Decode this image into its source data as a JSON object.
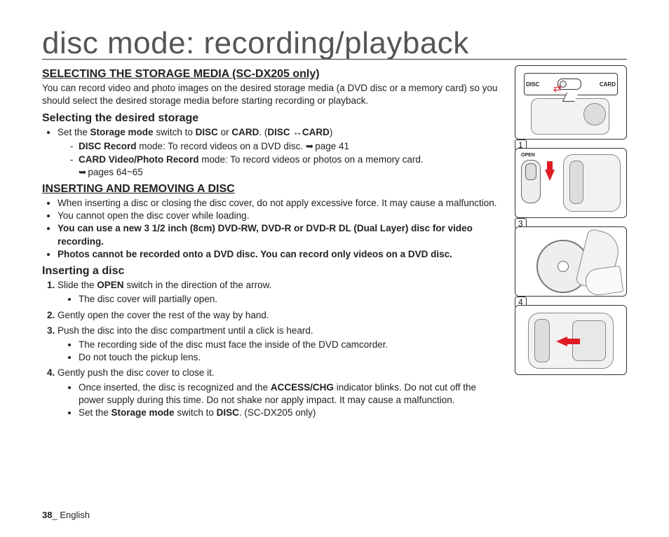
{
  "title": "disc mode: recording/playback",
  "section1": {
    "heading": "SELECTING THE STORAGE MEDIA (SC-DX205 only)",
    "intro": "You can record video and photo images on the desired storage media (a DVD disc or a memory card) so you should select the desired storage media before starting recording or playback.",
    "sub_heading": "Selecting the desired storage",
    "b1_pre": "Set the ",
    "b1_sm": "Storage mode",
    "b1_mid": " switch to ",
    "b1_disc": "DISC",
    "b1_or": " or ",
    "b1_card": "CARD",
    "b1_dot": ". (",
    "b1_disc2": "DISC",
    "b1_card2": "CARD",
    "b1_close": ")",
    "sub1_a": "DISC Record",
    "sub1_b": " mode: To record videos on a DVD disc. ",
    "sub1_c": "page 41",
    "sub2_a": "CARD Video/Photo Record",
    "sub2_b": " mode: To record videos or photos on a memory card.",
    "sub2_c": "pages 64~65"
  },
  "section2": {
    "heading": "INSERTING AND REMOVING A DISC",
    "b1": "When inserting a disc or closing the disc cover, do not apply excessive force. It may cause a malfunction.",
    "b2": "You cannot open the disc cover while loading.",
    "b3": "You can use a new 3 1/2 inch (8cm) DVD-RW, DVD-R or DVD-R DL (Dual Layer) disc for video recording.",
    "b4": "Photos cannot be recorded onto a DVD disc. You can record only videos on a DVD disc."
  },
  "section3": {
    "heading": "Inserting a disc",
    "s1a": "Slide the ",
    "s1b": "OPEN",
    "s1c": " switch in the direction of the arrow.",
    "s1_sub": "The disc cover will partially open.",
    "s2": "Gently open the cover the rest of the way by hand.",
    "s3": "Push the disc into the disc compartment until a click is heard.",
    "s3_sub1": "The recording side of the disc must face the inside of the DVD camcorder.",
    "s3_sub2": "Do not touch the pickup lens.",
    "s4": "Gently push the disc cover to close it.",
    "s4_sub1a": "Once inserted, the disc is recognized and the ",
    "s4_sub1b": "ACCESS/CHG",
    "s4_sub1c": " indicator blinks. Do not cut off the power supply during this time. Do not shake nor apply impact. It may cause a malfunction.",
    "s4_sub2a": "Set the ",
    "s4_sub2b": "Storage mode",
    "s4_sub2c": " switch to ",
    "s4_sub2d": "DISC",
    "s4_sub2e": ". (SC-DX205 only)"
  },
  "figs": {
    "a_disc": "DISC",
    "a_card": "CARD",
    "b_label": "1",
    "b_open": "OPEN",
    "c_label": "3",
    "d_label": "4"
  },
  "footer": {
    "page": "38",
    "sep": "_ ",
    "lang": "English"
  }
}
